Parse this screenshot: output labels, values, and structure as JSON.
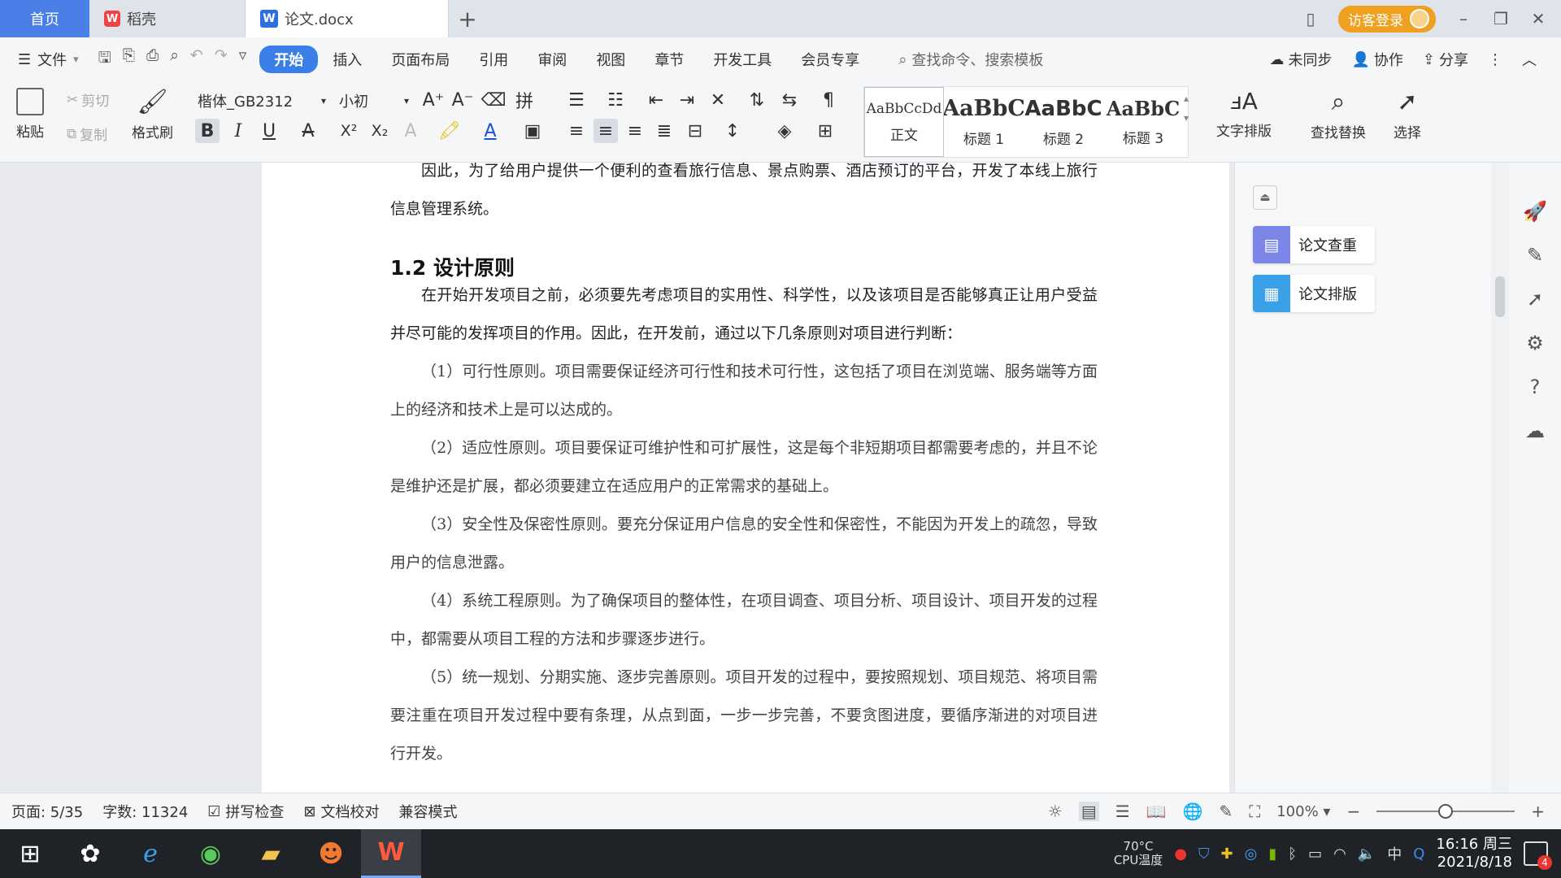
{
  "tabs": {
    "home": "首页",
    "wps": "稻壳",
    "doc": "论文.docx",
    "visitor_login": "访客登录"
  },
  "menu": {
    "file": "文件",
    "items": [
      "开始",
      "插入",
      "页面布局",
      "引用",
      "审阅",
      "视图",
      "章节",
      "开发工具",
      "会员专享"
    ],
    "search_placeholder": "查找命令、搜索模板",
    "sync": "未同步",
    "collab": "协作",
    "share": "分享"
  },
  "ribbon": {
    "paste": "粘贴",
    "cut": "剪切",
    "copy": "复制",
    "format_painter": "格式刷",
    "font_name": "楷体_GB2312",
    "font_size": "小初",
    "styles": [
      {
        "preview": "AaBbCcDd",
        "name": "正文"
      },
      {
        "preview": "AaBbC",
        "name": "标题 1"
      },
      {
        "preview": "AaBbC",
        "name": "标题 2"
      },
      {
        "preview": "AaBbC",
        "name": "标题 3"
      }
    ],
    "text_layout": "文字排版",
    "find_replace": "查找替换",
    "select": "选择"
  },
  "document": {
    "p_intro": "因此，为了给用户提供一个便利的查看旅行信息、景点购票、酒店预订的平台，开发了本线上旅行信息管理系统。",
    "heading": "1.2  设计原则",
    "p1": "在开始开发项目之前，必须要先考虑项目的实用性、科学性，以及该项目是否能够真正让用户受益并尽可能的发挥项目的作用。因此，在开发前，通过以下几条原则对项目进行判断：",
    "p2": "（1）可行性原则。项目需要保证经济可行性和技术可行性，这包括了项目在浏览端、服务端等方面上的经济和技术上是可以达成的。",
    "p3": "（2）适应性原则。项目要保证可维护性和可扩展性，这是每个非短期项目都需要考虑的，并且不论是维护还是扩展，都必须要建立在适应用户的正常需求的基础上。",
    "p4": "（3）安全性及保密性原则。要充分保证用户信息的安全性和保密性，不能因为开发上的疏忽，导致用户的信息泄露。",
    "p5": "（4）系统工程原则。为了确保项目的整体性，在项目调查、项目分析、项目设计、项目开发的过程中，都需要从项目工程的方法和步骤逐步进行。",
    "p6": "（5）统一规划、分期实施、逐步完善原则。项目开发的过程中，要按照规划、项目规范、将项目需要注重在项目开发过程中要有条理，从点到面，一步一步完善，不要贪图进度，要循序渐进的对项目进行开发。"
  },
  "taskpane": {
    "check": "论文查重",
    "layout": "论文排版"
  },
  "status": {
    "page": "页面: 5/35",
    "words": "字数: 11324",
    "spell": "拼写检查",
    "proof": "文档校对",
    "compat": "兼容模式",
    "zoom": "100%",
    "zoom_fraction": 0.5
  },
  "taskbar": {
    "cpu_temp": "70°C",
    "cpu_label": "CPU温度",
    "ime": "中",
    "time": "16:16 周三",
    "date": "2021/8/18",
    "notif_count": "4"
  },
  "colors": {
    "accent": "#3a7ee8",
    "home_tab": "#4a7fe8",
    "visitor": "#f0a020",
    "check_icon": "#7b86e8",
    "layout_icon": "#3aa0e8"
  }
}
